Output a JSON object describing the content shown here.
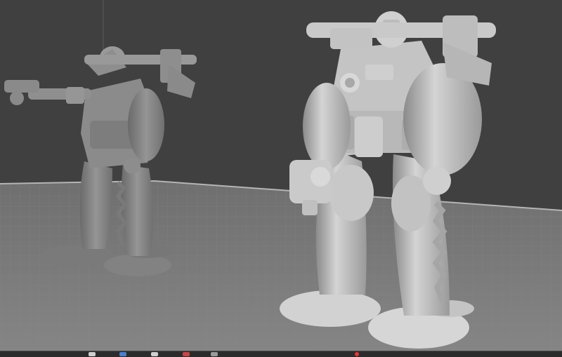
{
  "app": {
    "title": ""
  },
  "viewport": {
    "background_color": "#3e3e3e",
    "floor_color": "#7e7e7e",
    "grid_line_color": "#8d8d8d",
    "model_color": "#bdbdbd",
    "model_shadow_color": "#6a6a6a"
  },
  "scene": {
    "models": [
      {
        "name": "mech-figure-left",
        "icon": "mech-icon"
      },
      {
        "name": "mech-figure-right",
        "icon": "mech-icon"
      }
    ]
  },
  "taskbar": {
    "icons": [
      "app-icon",
      "folder-icon",
      "browser-icon",
      "terminal-icon",
      "settings-icon",
      "record-icon"
    ],
    "accent_colors": [
      "#cfcfcf",
      "#4a7fd0",
      "#d0d0d0",
      "#c44",
      "#e33"
    ]
  }
}
